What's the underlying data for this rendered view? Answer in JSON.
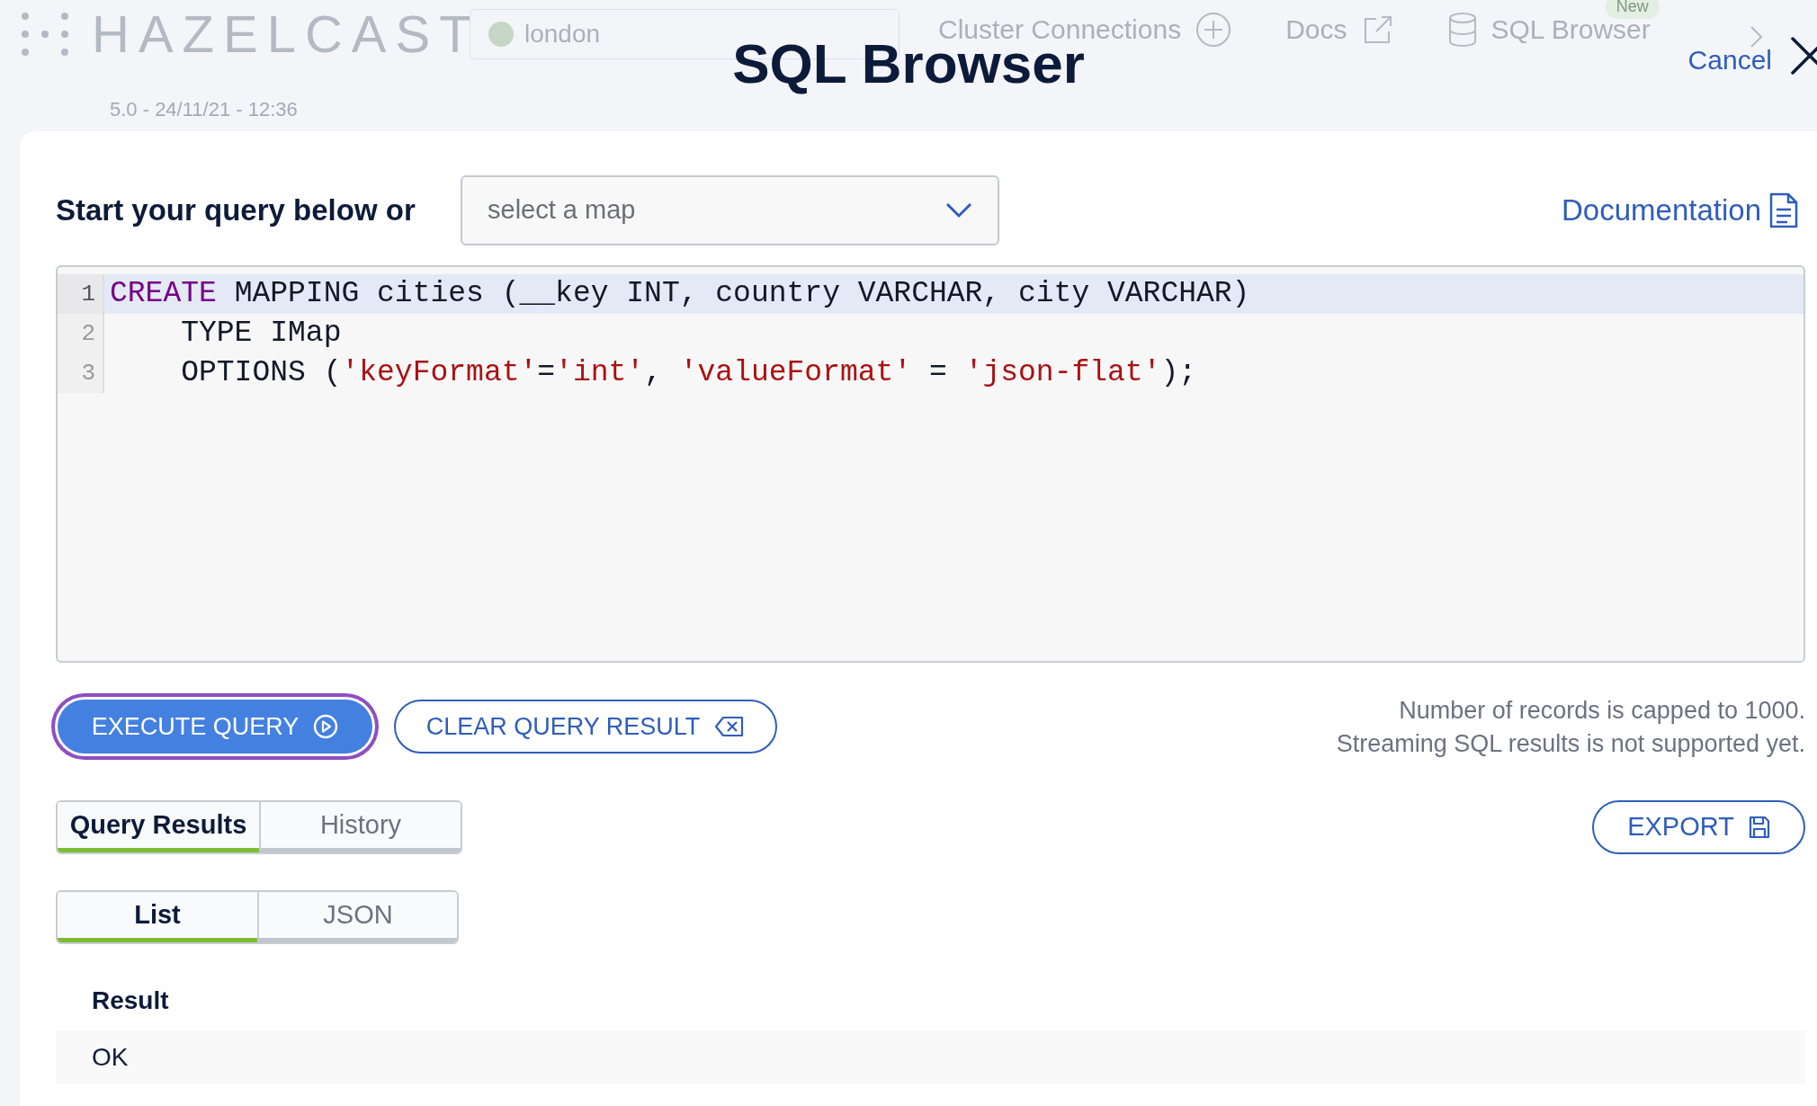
{
  "background": {
    "logo": "HAZELCAST",
    "cluster": "london",
    "version": "5.0 - 24/11/21 - 12:36",
    "nav": [
      {
        "label": "Cluster Connections"
      },
      {
        "label": "Docs"
      },
      {
        "label": "SQL Browser",
        "badge": "New"
      }
    ]
  },
  "dialog": {
    "title": "SQL Browser",
    "cancel": "Cancel"
  },
  "query_label": "Start your query below or",
  "map_select": {
    "placeholder": "select a map"
  },
  "documentation_link": "Documentation",
  "editor": {
    "lines": [
      {
        "number": "1",
        "active": true,
        "tokens": [
          {
            "kind": "keyword",
            "text": "CREATE"
          },
          {
            "kind": "plain",
            "text": " MAPPING cities (__key INT, country VARCHAR, city VARCHAR)"
          }
        ]
      },
      {
        "number": "2",
        "active": false,
        "tokens": [
          {
            "kind": "plain",
            "text": "    TYPE IMap"
          }
        ]
      },
      {
        "number": "3",
        "active": false,
        "tokens": [
          {
            "kind": "plain",
            "text": "    OPTIONS ("
          },
          {
            "kind": "string",
            "text": "'keyFormat'"
          },
          {
            "kind": "plain",
            "text": "="
          },
          {
            "kind": "string",
            "text": "'int'"
          },
          {
            "kind": "plain",
            "text": ", "
          },
          {
            "kind": "string",
            "text": "'valueFormat'"
          },
          {
            "kind": "plain",
            "text": " = "
          },
          {
            "kind": "string",
            "text": "'json-flat'"
          },
          {
            "kind": "plain",
            "text": ");"
          }
        ]
      }
    ]
  },
  "buttons": [
    {
      "label": "EXECUTE QUERY",
      "kind": "primary",
      "focused": true
    },
    {
      "label": "CLEAR QUERY RESULT",
      "kind": "outline",
      "focused": false
    }
  ],
  "notes": [
    "Number of records is capped to 1000.",
    "Streaming SQL results is not supported yet."
  ],
  "result_tabs": [
    {
      "label": "Query Results",
      "selected": true
    },
    {
      "label": "History",
      "selected": false
    }
  ],
  "export_button": "EXPORT",
  "view_tabs": [
    {
      "label": "List",
      "selected": true
    },
    {
      "label": "JSON",
      "selected": false
    }
  ],
  "result_table": {
    "columns": [
      "Result"
    ],
    "rows": [
      [
        "OK"
      ]
    ]
  }
}
